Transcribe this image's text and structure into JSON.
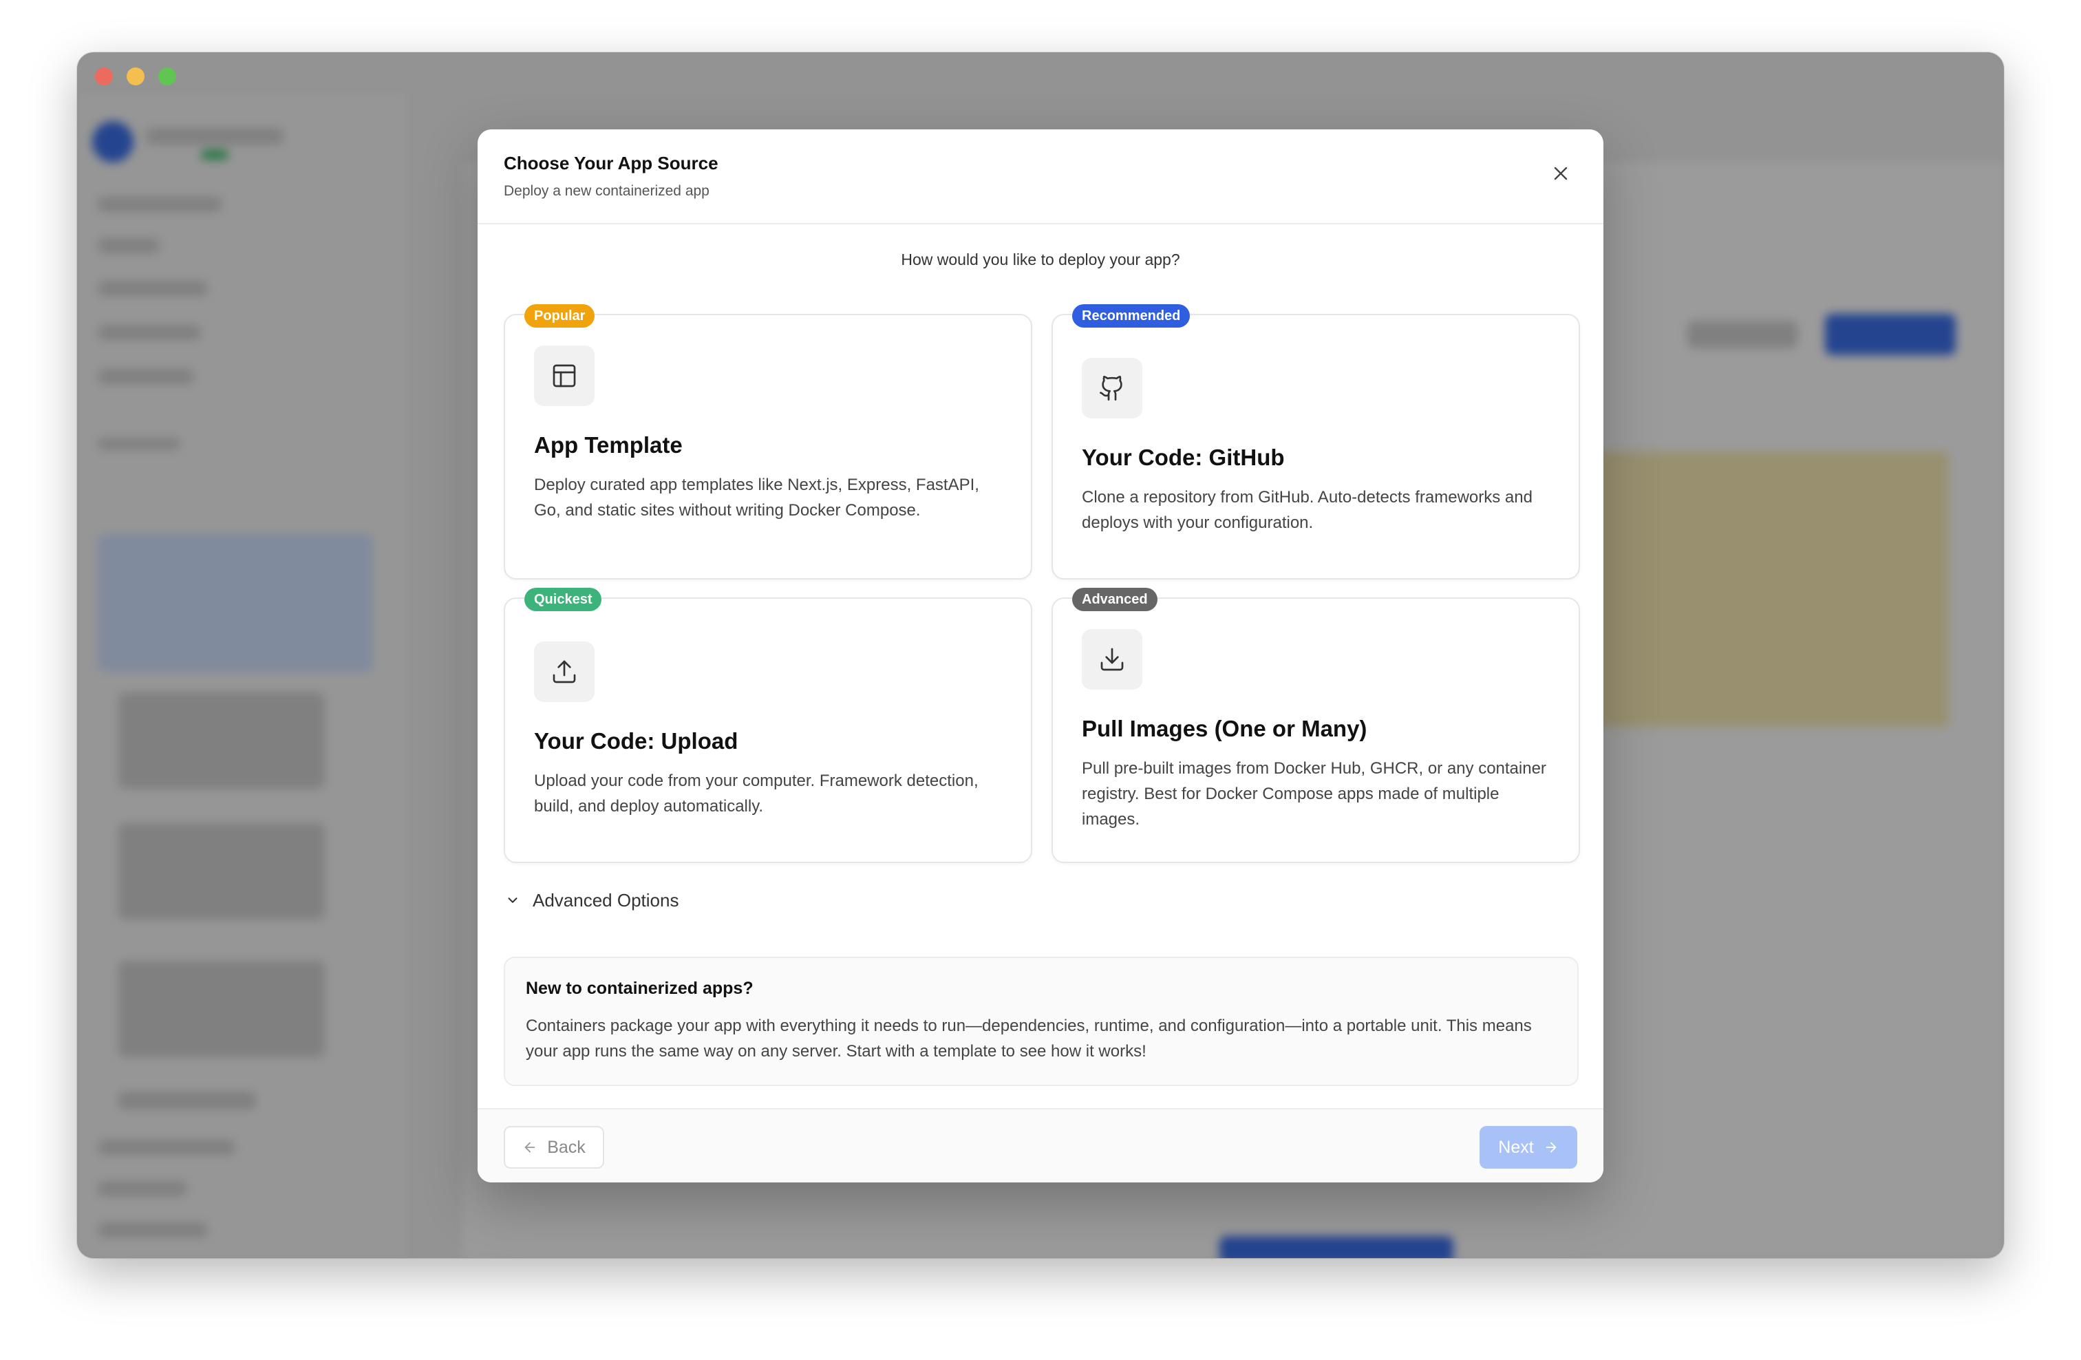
{
  "modal": {
    "title": "Choose Your App Source",
    "subtitle": "Deploy a new containerized app",
    "question": "How would you like to deploy your app?",
    "options": [
      {
        "badge": "Popular",
        "badge_color": "#f0a30a",
        "icon": "layout-template-icon",
        "title": "App Template",
        "description": "Deploy curated app templates like Next.js, Express, FastAPI, Go, and static sites without writing Docker Compose."
      },
      {
        "badge": "Recommended",
        "badge_color": "#2f5fe0",
        "icon": "github-icon",
        "title": "Your Code: GitHub",
        "description": "Clone a repository from GitHub. Auto-detects frameworks and deploys with your configuration."
      },
      {
        "badge": "Quickest",
        "badge_color": "#3bb37a",
        "icon": "upload-icon",
        "title": "Your Code: Upload",
        "description": "Upload your code from your computer. Framework detection, build, and deploy automatically."
      },
      {
        "badge": "Advanced",
        "badge_color": "#666666",
        "icon": "download-icon",
        "title": "Pull Images (One or Many)",
        "description": "Pull pre-built images from Docker Hub, GHCR, or any container registry. Best for Docker Compose apps made of multiple images."
      }
    ],
    "advanced_options_label": "Advanced Options",
    "info": {
      "title": "New to containerized apps?",
      "text": "Containers package your app with everything it needs to run—dependencies, runtime, and configuration—into a portable unit. This means your app runs the same way on any server. Start with a template to see how it works!"
    },
    "footer": {
      "back_label": "Back",
      "next_label": "Next"
    }
  }
}
